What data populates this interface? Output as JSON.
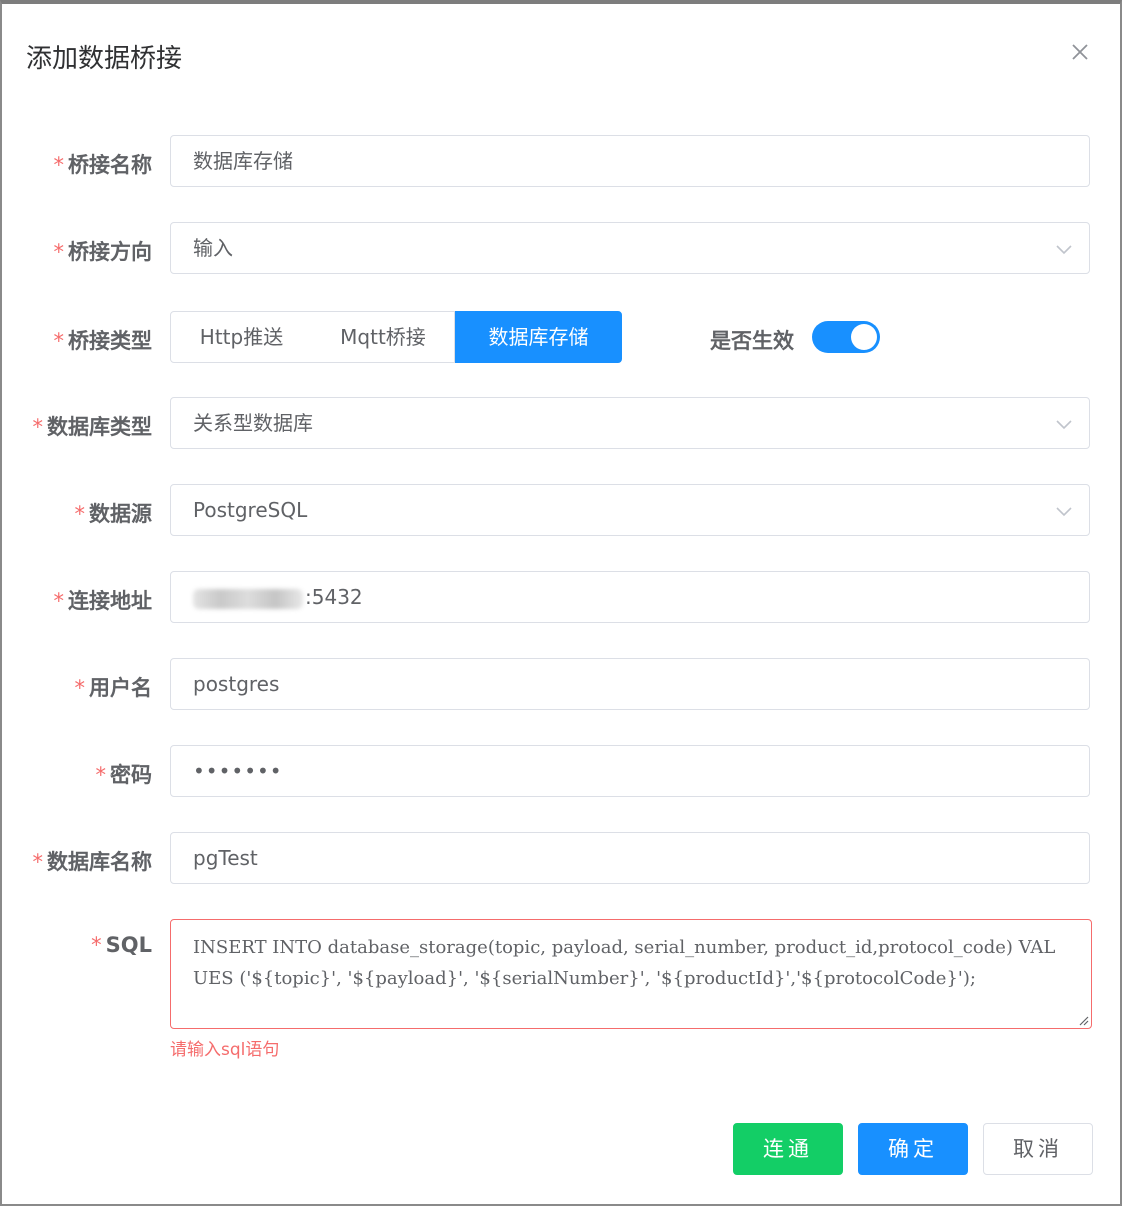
{
  "dialog": {
    "title": "添加数据桥接"
  },
  "form": {
    "bridge_name": {
      "label": "桥接名称",
      "value": "数据库存储"
    },
    "bridge_direction": {
      "label": "桥接方向",
      "value": "输入"
    },
    "bridge_type": {
      "label": "桥接类型",
      "options": [
        "Http推送",
        "Mqtt桥接",
        "数据库存储"
      ],
      "selected": "数据库存储"
    },
    "enabled": {
      "label": "是否生效",
      "value": true
    },
    "db_type": {
      "label": "数据库类型",
      "value": "关系型数据库"
    },
    "data_source": {
      "label": "数据源",
      "value": "PostgreSQL"
    },
    "connection_address": {
      "label": "连接地址",
      "value_visible_suffix": ":5432"
    },
    "username": {
      "label": "用户名",
      "value": "postgres"
    },
    "password": {
      "label": "密码",
      "value": "•••••••"
    },
    "db_name": {
      "label": "数据库名称",
      "value": "pgTest"
    },
    "sql": {
      "label": "SQL",
      "value": "INSERT INTO database_storage(topic, payload, serial_number, product_id,protocol_code) VALUES ('${topic}', '${payload}', '${serialNumber}', '${productId}','${protocolCode}');",
      "error": "请输入sql语句"
    }
  },
  "footer": {
    "connect_label": "连通",
    "confirm_label": "确定",
    "cancel_label": "取消"
  },
  "colors": {
    "primary": "#1890ff",
    "success": "#13ce66",
    "danger": "#f56c6c"
  },
  "icons": [
    "close-icon",
    "chevron-down-icon",
    "resize-handle-icon"
  ]
}
